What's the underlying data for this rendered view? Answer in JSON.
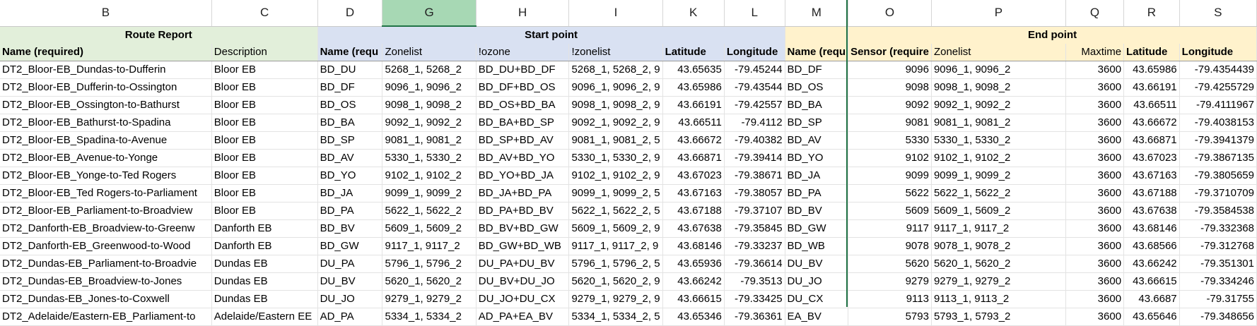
{
  "columns": [
    "B",
    "C",
    "D",
    "G",
    "H",
    "I",
    "K",
    "L",
    "M",
    "O",
    "P",
    "Q",
    "R",
    "S"
  ],
  "selected_column": "G",
  "colors": {
    "header_green": "#e2efda",
    "header_blue": "#d9e1f2",
    "header_orange": "#fff2cc",
    "selected_col": "#a7d8b4",
    "freeze_line": "#217346"
  },
  "groups": {
    "route_report": "Route Report",
    "start_point": "Start point",
    "end_point": "End point"
  },
  "subheaders": [
    "Name (required)",
    "Description",
    "Name (requ",
    "Zonelist",
    "!ozone",
    "!zonelist",
    "Latitude",
    "Longitude",
    "Name  (requ",
    "Sensor (require",
    "Zonelist",
    "Maxtime",
    "Latitude",
    "Longitude"
  ],
  "rows": [
    [
      "DT2_Bloor-EB_Dundas-to-Dufferin",
      "Bloor EB",
      "BD_DU",
      "5268_1, 5268_2",
      "BD_DU+BD_DF",
      "5268_1, 5268_2, 9",
      "43.65635",
      "-79.45244",
      "BD_DF",
      "9096",
      "9096_1, 9096_2",
      "3600",
      "43.65986",
      "-79.4354439"
    ],
    [
      "DT2_Bloor-EB_Dufferin-to-Ossington",
      "Bloor EB",
      "BD_DF",
      "9096_1, 9096_2",
      "BD_DF+BD_OS",
      "9096_1, 9096_2, 9",
      "43.65986",
      "-79.43544",
      "BD_OS",
      "9098",
      "9098_1, 9098_2",
      "3600",
      "43.66191",
      "-79.4255729"
    ],
    [
      "DT2_Bloor-EB_Ossington-to-Bathurst",
      "Bloor EB",
      "BD_OS",
      "9098_1, 9098_2",
      "BD_OS+BD_BA",
      "9098_1, 9098_2, 9",
      "43.66191",
      "-79.42557",
      "BD_BA",
      "9092",
      "9092_1, 9092_2",
      "3600",
      "43.66511",
      "-79.4111967"
    ],
    [
      "DT2_Bloor-EB_Bathurst-to-Spadina",
      "Bloor EB",
      "BD_BA",
      "9092_1, 9092_2",
      "BD_BA+BD_SP",
      "9092_1, 9092_2, 9",
      "43.66511",
      "-79.4112",
      "BD_SP",
      "9081",
      "9081_1, 9081_2",
      "3600",
      "43.66672",
      "-79.4038153"
    ],
    [
      "DT2_Bloor-EB_Spadina-to-Avenue",
      "Bloor EB",
      "BD_SP",
      "9081_1, 9081_2",
      "BD_SP+BD_AV",
      "9081_1, 9081_2, 5",
      "43.66672",
      "-79.40382",
      "BD_AV",
      "5330",
      "5330_1, 5330_2",
      "3600",
      "43.66871",
      "-79.3941379"
    ],
    [
      "DT2_Bloor-EB_Avenue-to-Yonge",
      "Bloor EB",
      "BD_AV",
      "5330_1, 5330_2",
      "BD_AV+BD_YO",
      "5330_1, 5330_2, 9",
      "43.66871",
      "-79.39414",
      "BD_YO",
      "9102",
      "9102_1, 9102_2",
      "3600",
      "43.67023",
      "-79.3867135"
    ],
    [
      "DT2_Bloor-EB_Yonge-to-Ted Rogers",
      "Bloor EB",
      "BD_YO",
      "9102_1, 9102_2",
      "BD_YO+BD_JA",
      "9102_1, 9102_2, 9",
      "43.67023",
      "-79.38671",
      "BD_JA",
      "9099",
      "9099_1, 9099_2",
      "3600",
      "43.67163",
      "-79.3805659"
    ],
    [
      "DT2_Bloor-EB_Ted Rogers-to-Parliament",
      "Bloor EB",
      "BD_JA",
      "9099_1, 9099_2",
      "BD_JA+BD_PA",
      "9099_1, 9099_2, 5",
      "43.67163",
      "-79.38057",
      "BD_PA",
      "5622",
      "5622_1, 5622_2",
      "3600",
      "43.67188",
      "-79.3710709"
    ],
    [
      "DT2_Bloor-EB_Parliament-to-Broadview",
      "Bloor EB",
      "BD_PA",
      "5622_1, 5622_2",
      "BD_PA+BD_BV",
      "5622_1, 5622_2, 5",
      "43.67188",
      "-79.37107",
      "BD_BV",
      "5609",
      "5609_1, 5609_2",
      "3600",
      "43.67638",
      "-79.3584538"
    ],
    [
      "DT2_Danforth-EB_Broadview-to-Greenw",
      "Danforth EB",
      "BD_BV",
      "5609_1, 5609_2",
      "BD_BV+BD_GW",
      "5609_1, 5609_2, 9",
      "43.67638",
      "-79.35845",
      "BD_GW",
      "9117",
      "9117_1, 9117_2",
      "3600",
      "43.68146",
      "-79.332368"
    ],
    [
      "DT2_Danforth-EB_Greenwood-to-Wood",
      "Danforth EB",
      "BD_GW",
      "9117_1, 9117_2",
      "BD_GW+BD_WB",
      "9117_1, 9117_2, 9",
      "43.68146",
      "-79.33237",
      "BD_WB",
      "9078",
      "9078_1, 9078_2",
      "3600",
      "43.68566",
      "-79.312768"
    ],
    [
      "DT2_Dundas-EB_Parliament-to-Broadvie",
      "Dundas EB",
      "DU_PA",
      "5796_1, 5796_2",
      "DU_PA+DU_BV",
      "5796_1, 5796_2, 5",
      "43.65936",
      "-79.36614",
      "DU_BV",
      "5620",
      "5620_1, 5620_2",
      "3600",
      "43.66242",
      "-79.351301"
    ],
    [
      "DT2_Dundas-EB_Broadview-to-Jones",
      "Dundas EB",
      "DU_BV",
      "5620_1, 5620_2",
      "DU_BV+DU_JO",
      "5620_1, 5620_2, 9",
      "43.66242",
      "-79.3513",
      "DU_JO",
      "9279",
      "9279_1, 9279_2",
      "3600",
      "43.66615",
      "-79.334246"
    ],
    [
      "DT2_Dundas-EB_Jones-to-Coxwell",
      "Dundas EB",
      "DU_JO",
      "9279_1, 9279_2",
      "DU_JO+DU_CX",
      "9279_1, 9279_2, 9",
      "43.66615",
      "-79.33425",
      "DU_CX",
      "9113",
      "9113_1, 9113_2",
      "3600",
      "43.6687",
      "-79.31755"
    ],
    [
      "DT2_Adelaide/Eastern-EB_Parliament-to",
      "Adelaide/Eastern EE",
      "AD_PA",
      "5334_1, 5334_2",
      "AD_PA+EA_BV",
      "5334_1, 5334_2, 5",
      "43.65346",
      "-79.36361",
      "EA_BV",
      "5793",
      "5793_1, 5793_2",
      "3600",
      "43.65646",
      "-79.348656"
    ]
  ]
}
